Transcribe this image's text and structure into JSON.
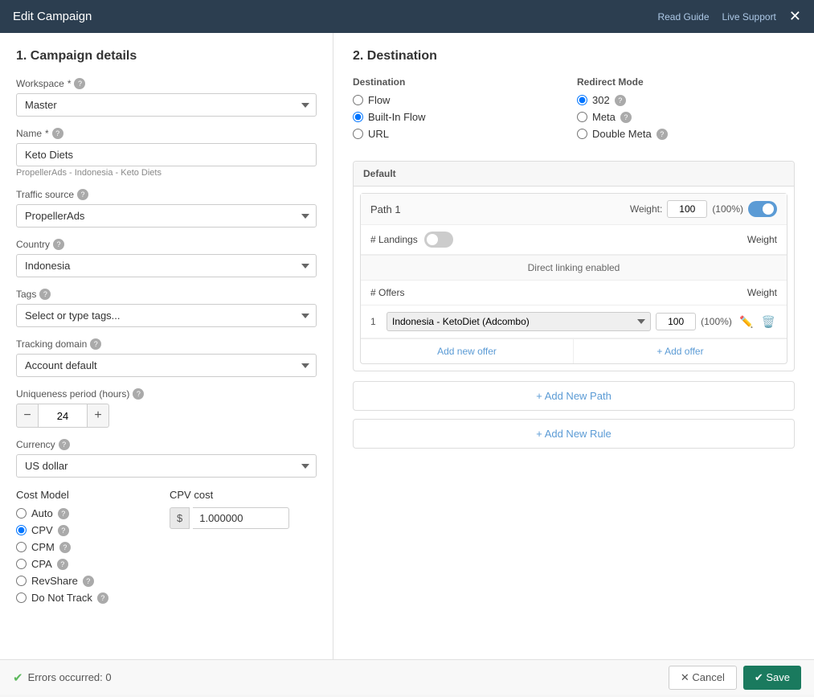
{
  "header": {
    "title": "Edit Campaign",
    "read_guide": "Read Guide",
    "live_support": "Live Support"
  },
  "left": {
    "section_title": "1. Campaign details",
    "workspace": {
      "label": "Workspace",
      "required": true,
      "value": "Master",
      "placeholder": "Master"
    },
    "name": {
      "label": "Name",
      "required": true,
      "value": "Keto Diets",
      "hint": "PropellerAds - Indonesia - Keto Diets"
    },
    "traffic_source": {
      "label": "Traffic source",
      "value": "PropellerAds"
    },
    "country": {
      "label": "Country",
      "value": "Indonesia"
    },
    "tags": {
      "label": "Tags",
      "placeholder": "Select or type tags..."
    },
    "tracking_domain": {
      "label": "Tracking domain",
      "value": "Account default"
    },
    "uniqueness_period": {
      "label": "Uniqueness period (hours)",
      "value": "24"
    },
    "currency": {
      "label": "Currency",
      "value": "US dollar"
    },
    "cost_model": {
      "label": "Cost Model",
      "options": [
        {
          "value": "auto",
          "label": "Auto",
          "checked": false
        },
        {
          "value": "cpv",
          "label": "CPV",
          "checked": true
        },
        {
          "value": "cpm",
          "label": "CPM",
          "checked": false
        },
        {
          "value": "cpa",
          "label": "CPA",
          "checked": false
        },
        {
          "value": "revshare",
          "label": "RevShare",
          "checked": false
        },
        {
          "value": "donottrack",
          "label": "Do Not Track",
          "checked": false
        }
      ]
    },
    "cpv_cost": {
      "label": "CPV cost",
      "currency_symbol": "$",
      "value": "1.000000"
    }
  },
  "right": {
    "section_title": "2. Destination",
    "destination": {
      "label": "Destination",
      "options": [
        {
          "value": "flow",
          "label": "Flow",
          "checked": false
        },
        {
          "value": "builtin_flow",
          "label": "Built-In Flow",
          "checked": true
        },
        {
          "value": "url",
          "label": "URL",
          "checked": false
        }
      ]
    },
    "redirect_mode": {
      "label": "Redirect Mode",
      "options": [
        {
          "value": "302",
          "label": "302",
          "checked": true
        },
        {
          "value": "meta",
          "label": "Meta",
          "checked": false
        },
        {
          "value": "double_meta",
          "label": "Double Meta",
          "checked": false
        }
      ]
    },
    "rule": {
      "name": "Default",
      "path": {
        "title": "Path 1",
        "weight_label": "Weight:",
        "weight_value": "100",
        "weight_pct": "(100%)",
        "toggle_on": true,
        "landings": {
          "title": "# Landings",
          "weight_col": "Weight",
          "toggle_on": false,
          "direct_linking": "Direct linking enabled"
        },
        "offers": {
          "title": "# Offers",
          "weight_col": "Weight",
          "items": [
            {
              "num": "1",
              "label": "Indonesia - KetoDiet (Adcombo)",
              "weight": "100",
              "pct": "(100%)"
            }
          ],
          "add_new_offer": "Add new offer",
          "add_offer": "+ Add offer"
        }
      },
      "add_path_btn": "+ Add New Path",
      "add_rule_btn": "+ Add New Rule"
    }
  },
  "footer": {
    "error_text": "Errors occurred: 0",
    "cancel_label": "✕ Cancel",
    "save_label": "✔ Save"
  }
}
